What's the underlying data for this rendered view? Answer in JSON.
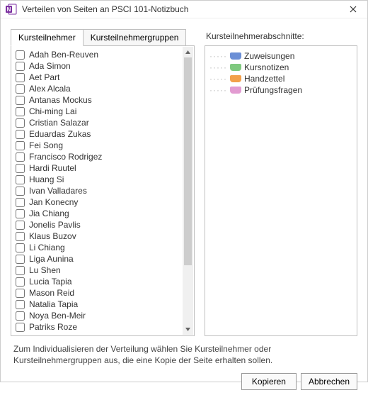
{
  "window": {
    "title": "Verteilen von Seiten an PSCI 101-Notizbuch"
  },
  "tabs": {
    "participants": "Kursteilnehmer",
    "groups": "Kursteilnehmergruppen"
  },
  "sections_header": "Kursteilnehmerabschnitte:",
  "students": [
    "Adah Ben-Reuven",
    "Ada Simon",
    "Aet Part",
    "Alex Alcala",
    "Antanas Mockus",
    "Chi-ming Lai",
    "Cristian Salazar",
    "Eduardas Zukas",
    "Fei Song",
    "Francisco Rodrigez",
    "Hardi Ruutel",
    "Huang Si",
    "Ivan Valladares",
    "Jan Konecny",
    "Jia Chiang",
    "Jonelis Pavlis",
    "Klaus Buzov",
    "Li Chiang",
    "Liga Aunina",
    "Lu Shen",
    "Lucia Tapia",
    "Mason Reid",
    "Natalia Tapia",
    "Noya Ben-Meir",
    "Patriks Roze"
  ],
  "sections": [
    {
      "label": "Zuweisungen",
      "color": "#6b8fd6"
    },
    {
      "label": "Kursnotizen",
      "color": "#7fc97f"
    },
    {
      "label": "Handzettel",
      "color": "#f2a04a"
    },
    {
      "label": "Prüfungsfragen",
      "color": "#e29bd1"
    }
  ],
  "help_text": "Zum Individualisieren der Verteilung wählen Sie Kursteilnehmer oder Kursteilnehmergruppen aus, die eine Kopie der Seite erhalten sollen.",
  "buttons": {
    "copy": "Kopieren",
    "cancel": "Abbrechen"
  }
}
